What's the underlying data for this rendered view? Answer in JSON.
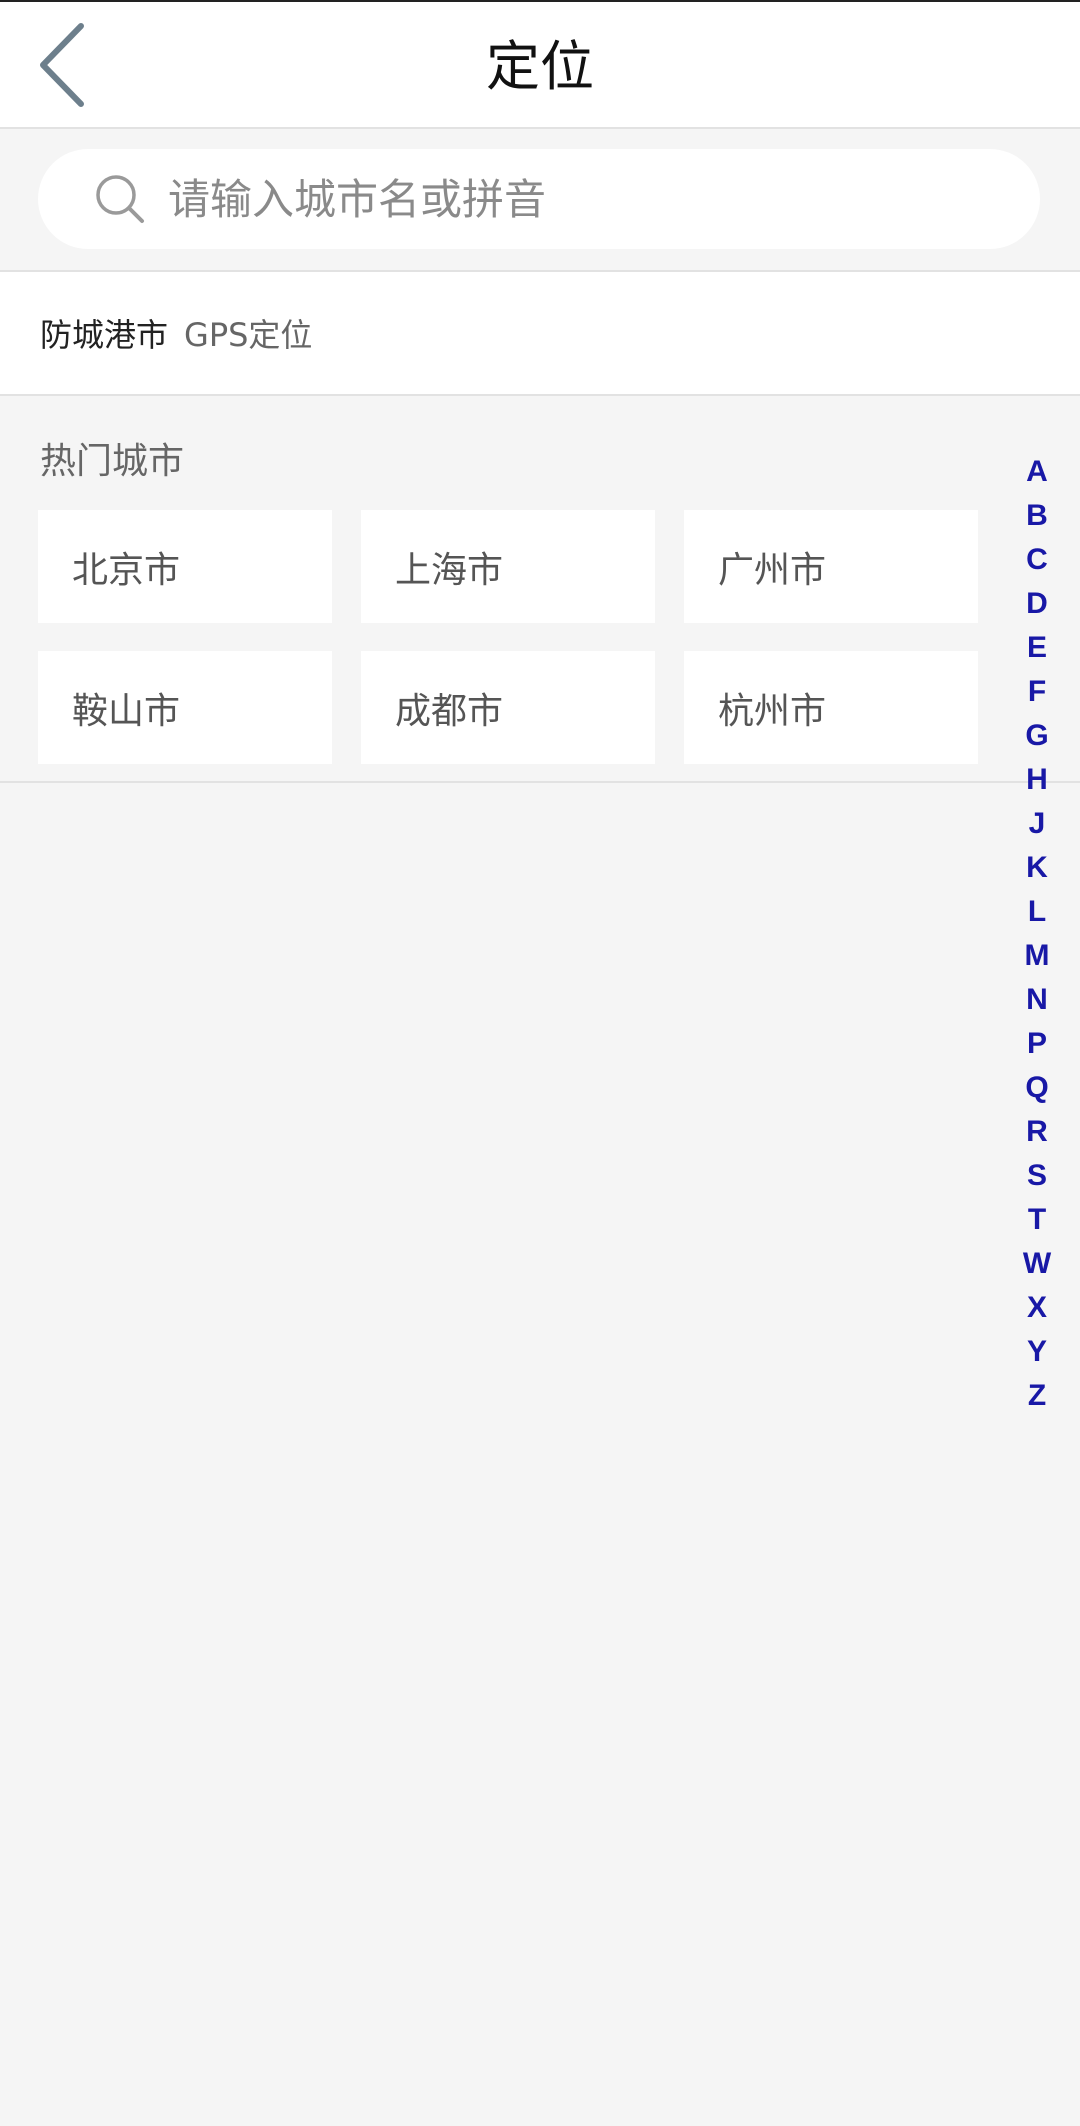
{
  "header": {
    "title": "定位",
    "back_icon": "chevron-left-icon"
  },
  "search": {
    "placeholder": "请输入城市名或拼音",
    "value": "",
    "icon": "search-icon"
  },
  "location": {
    "city": "防城港市",
    "tag": "GPS定位"
  },
  "hot": {
    "title": "热门城市",
    "cities": [
      "北京市",
      "上海市",
      "广州市",
      "鞍山市",
      "成都市",
      "杭州市"
    ]
  },
  "alphabet": [
    "A",
    "B",
    "C",
    "D",
    "E",
    "F",
    "G",
    "H",
    "J",
    "K",
    "L",
    "M",
    "N",
    "P",
    "Q",
    "R",
    "S",
    "T",
    "W",
    "X",
    "Y",
    "Z"
  ],
  "colors": {
    "index_letter": "#1818a6",
    "background": "#f5f5f5",
    "card": "#ffffff"
  }
}
